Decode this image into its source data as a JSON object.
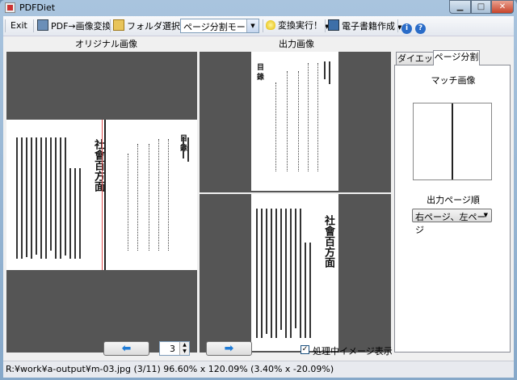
{
  "window": {
    "title": "PDFDiet"
  },
  "toolbar": {
    "exit_label": "Exit",
    "pdf_to_image_label": "PDF→画像変換",
    "folder_select_label": "フォルダ選択",
    "mode_value": "ページ分割モード",
    "convert_label": "変換実行！",
    "ebook_label": "電子書籍作成"
  },
  "panels": {
    "original_label": "オリジナル画像",
    "output_label": "出力画像"
  },
  "right_panel": {
    "tabs": [
      {
        "label": "ダイエット"
      },
      {
        "label": "ページ分割"
      }
    ],
    "match_label": "マッチ画像",
    "order_label": "出力ページ順",
    "order_value": "右ページ、左ページ"
  },
  "bottom": {
    "page_number": "3",
    "show_processing_label": "処理中イメージ表示"
  },
  "status": {
    "text": "R:¥work¥a-output¥m-03.jpg (3/11)  96.60% x 120.09% (3.40% x -20.09%)"
  },
  "colors": {
    "accent": "#1e7bd6",
    "preview_bg": "#555555",
    "split_line": "#e05050"
  }
}
